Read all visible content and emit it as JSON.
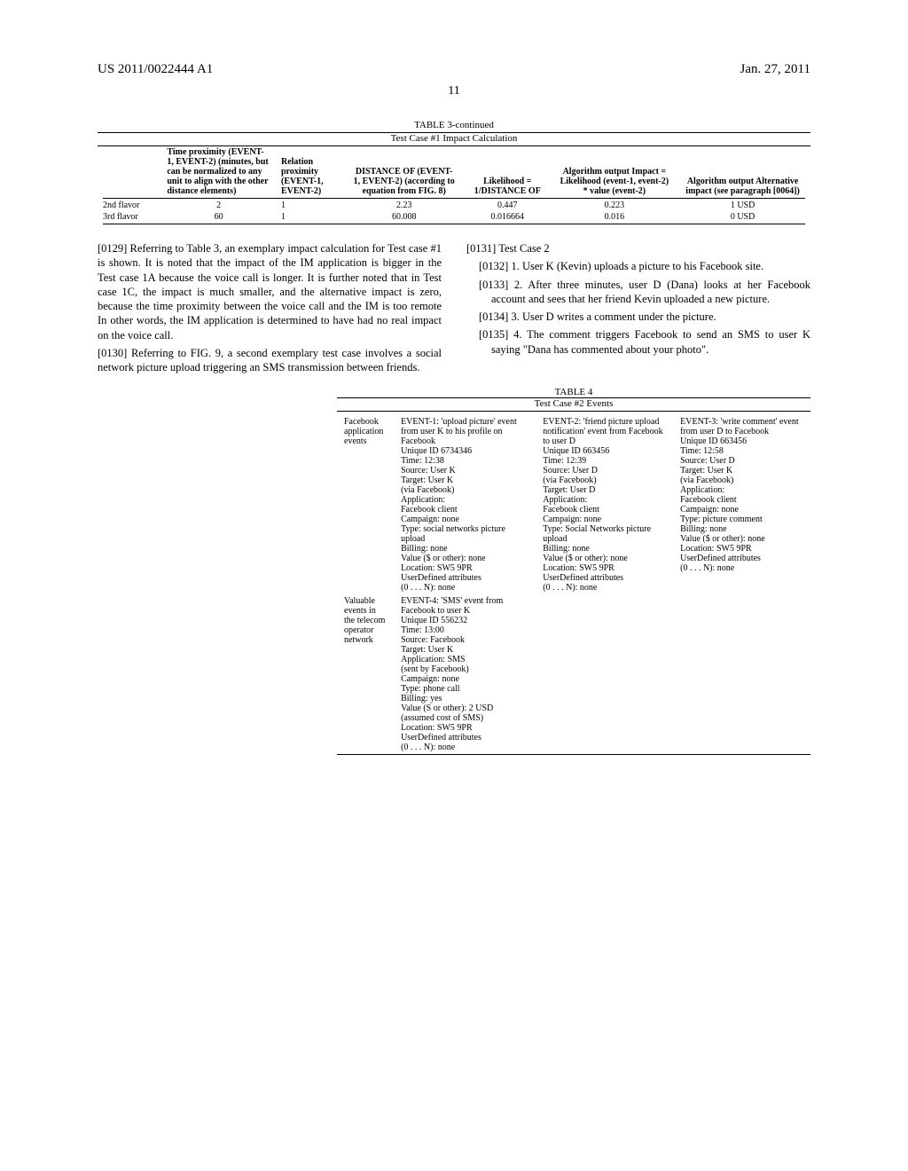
{
  "header": {
    "left": "US 2011/0022444 A1",
    "right": "Jan. 27, 2011"
  },
  "page_number": "11",
  "table3": {
    "title": "TABLE 3-continued",
    "caption": "Test Case #1 Impact Calculation",
    "headers": {
      "c0": "",
      "c1": "Time proximity (EVENT-1, EVENT-2) (minutes, but can be normalized to any unit to align with the other distance elements)",
      "c2": "Relation proximity (EVENT-1, EVENT-2)",
      "c3": "DISTANCE OF (EVENT-1, EVENT-2) (according to equation from FIG. 8)",
      "c4": "Likelihood = 1/DISTANCE OF",
      "c5": "Algorithm output Impact = Likelihood (event-1, event-2) * value (event-2)",
      "c6": "Algorithm output Alternative impact (see paragraph [0064])"
    },
    "rows": [
      {
        "label": "2nd flavor",
        "c1": "2",
        "c2": "1",
        "c3": "2.23",
        "c4": "0.447",
        "c5": "0.223",
        "c6": "1 USD"
      },
      {
        "label": "3rd flavor",
        "c1": "60",
        "c2": "1",
        "c3": "60.008",
        "c4": "0.016664",
        "c5": "0.016",
        "c6": "0 USD"
      }
    ]
  },
  "left_col": {
    "p0129": "[0129]    Referring to Table 3, an exemplary impact calculation for Test case #1 is shown. It is noted that the impact of the IM application is bigger in the Test case 1A because the voice call is longer. It is further noted that in Test case 1C, the impact is much smaller, and the alternative impact is zero, because the time proximity between the voice call and the IM is too remote In other words, the IM application is determined to have had no real impact on the voice call.",
    "p0130": "[0130]    Referring to FIG. 9, a second exemplary test case involves a social network picture upload triggering an SMS transmission between friends."
  },
  "right_col": {
    "p0131": "[0131]    Test Case 2",
    "p0132": "[0132]    1. User K (Kevin) uploads a picture to his Facebook site.",
    "p0133": "[0133]    2. After three minutes, user D (Dana) looks at her Facebook account and sees that her friend Kevin uploaded a new picture.",
    "p0134": "[0134]    3. User D writes a comment under the picture.",
    "p0135": "[0135]    4. The comment triggers Facebook to send an SMS to user K saying \"Dana has commented about your photo\"."
  },
  "table4": {
    "title": "TABLE 4",
    "caption": "Test Case #2 Events",
    "rows": [
      {
        "c0": "Facebook application events",
        "c1": "EVENT-1: 'upload picture' event from user K to his profile on Facebook\nUnique ID 6734346\nTime: 12:38\nSource: User K\nTarget: User K\n(via Facebook)\nApplication:\nFacebook client\nCampaign: none\nType: social networks picture upload\nBilling: none\nValue ($ or other): none\nLocation: SW5 9PR\nUserDefined attributes\n(0 . . . N): none",
        "c2": "EVENT-2: 'friend picture upload notification' event from Facebook to user D\nUnique ID 663456\nTime: 12:39\nSource: User D\n(via Facebook)\nTarget: User D\nApplication:\nFacebook client\nCampaign: none\nType: Social Networks picture upload\nBilling: none\nValue ($ or other): none\nLocation: SW5 9PR\nUserDefined attributes\n(0 . . . N): none",
        "c3": "EVENT-3: 'write comment' event from user D to Facebook\nUnique ID 663456\nTime: 12:58\nSource: User D\nTarget: User K\n(via Facebook)\nApplication:\nFacebook client\nCampaign: none\nType: picture comment\nBilling: none\nValue ($ or other): none\nLocation: SW5 9PR\nUserDefined attributes\n(0 . . . N): none"
      },
      {
        "c0": "Valuable events in the telecom operator network",
        "c1": "EVENT-4: 'SMS' event from Facebook to user K\nUnique ID 556232\nTime: 13:00\nSource: Facebook\nTarget: User K\nApplication: SMS\n(sent by Facebook)\nCampaign: none\nType: phone call\nBilling: yes\nValue (S or other): 2 USD\n(assumed cost of SMS)\nLocation: SW5 9PR\nUserDefined attributes\n(0 . . . N): none",
        "c2": "",
        "c3": ""
      }
    ]
  }
}
